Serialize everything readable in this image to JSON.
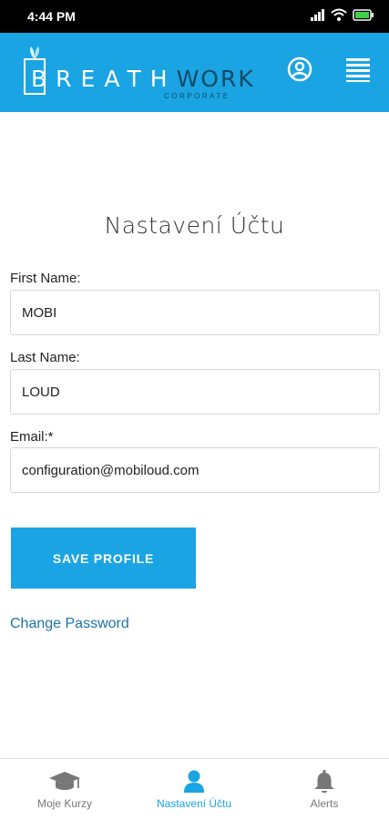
{
  "status_bar": {
    "time": "4:44 PM"
  },
  "header": {
    "logo_main": "BREATH",
    "logo_accent": "WORK",
    "logo_sub": "CORPORATE",
    "profile_icon": "user-circle-icon",
    "menu_icon": "hamburger-menu-icon"
  },
  "main": {
    "title": "Nastavení Účtu",
    "fields": [
      {
        "label": "First Name:",
        "value": "MOBI"
      },
      {
        "label": "Last Name:",
        "value": "LOUD"
      },
      {
        "label": "Email:*",
        "value": "configuration@mobiloud.com"
      }
    ],
    "save_label": "SAVE PROFILE",
    "change_password": "Change Password"
  },
  "bottom_nav": {
    "items": [
      {
        "label": "Moje Kurzy",
        "icon": "graduation-cap-icon"
      },
      {
        "label": "Nastavení Účtu",
        "icon": "user-icon",
        "active": true
      },
      {
        "label": "Alerts",
        "icon": "bell-icon"
      }
    ]
  },
  "colors": {
    "brand_blue": "#1aa4e3",
    "logo_dark": "#0f4a64",
    "link": "#1a73a8"
  }
}
